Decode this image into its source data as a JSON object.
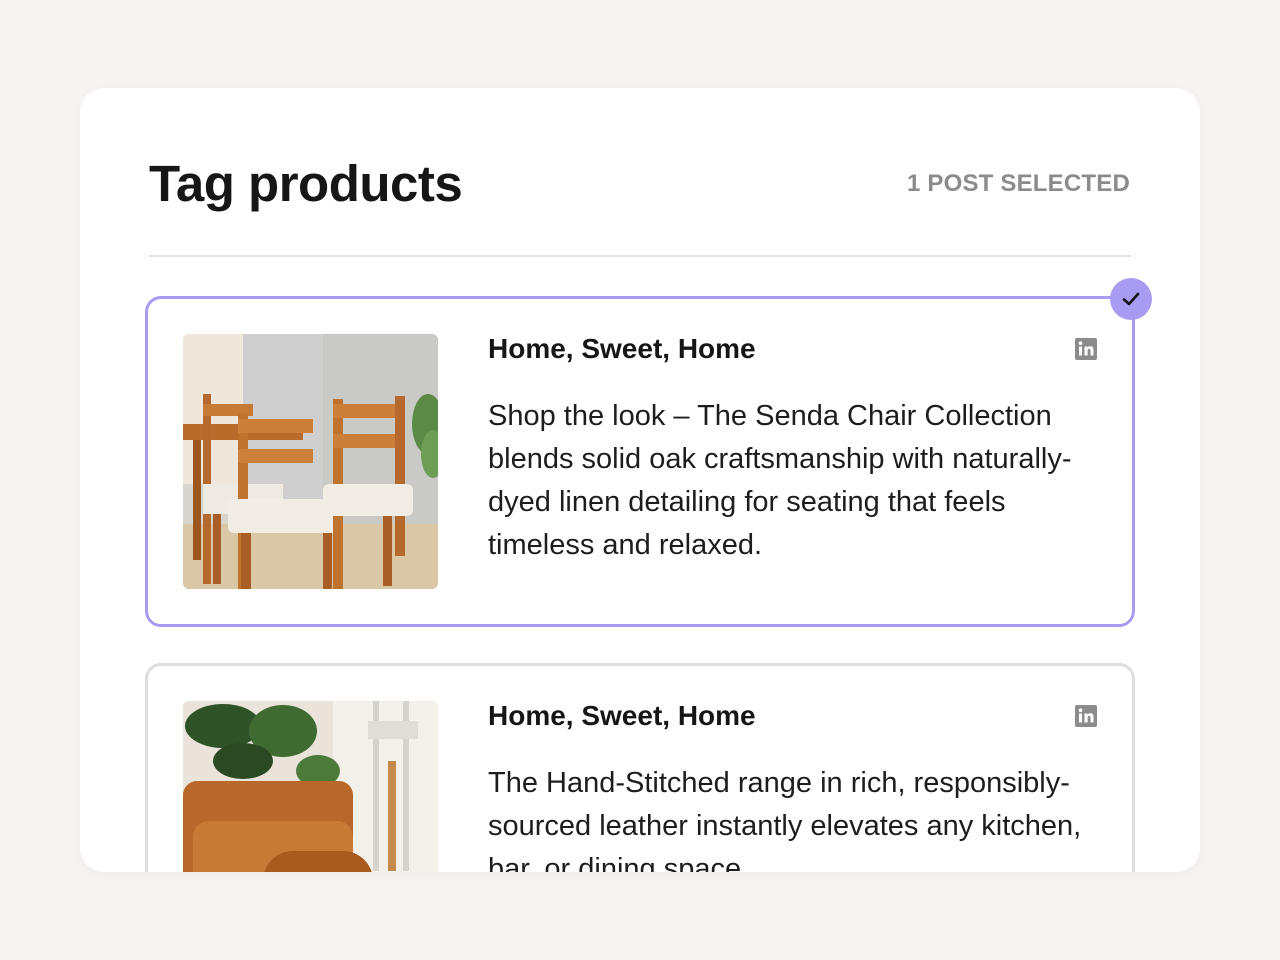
{
  "header": {
    "title": "Tag products",
    "selected_count": "1 POST SELECTED"
  },
  "posts": [
    {
      "title": "Home, Sweet, Home",
      "body": "Shop the look – The Senda Chair Collection blends solid oak craftsmanship with naturally-dyed linen detailing for seating that feels timeless and relaxed.",
      "network_icon": "linkedin-icon",
      "image": "wooden-dining-chairs-photo",
      "selected": true
    },
    {
      "title": "Home, Sweet, Home",
      "body": "The Hand-Stitched range in rich, responsibly-sourced leather instantly elevates any kitchen, bar, or dining space.",
      "network_icon": "linkedin-icon",
      "image": "leather-armchair-photo",
      "selected": false
    }
  ],
  "colors": {
    "accent": "#a79cf2",
    "background": "#f6f3f2",
    "panel": "#ffffff",
    "muted_text": "#8b8b8b",
    "unselected_border": "#dddddd"
  },
  "icons": {
    "check": "check-icon",
    "linkedin": "linkedin-icon"
  }
}
